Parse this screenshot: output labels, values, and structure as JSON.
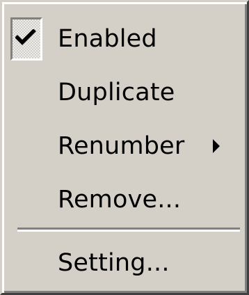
{
  "menu": {
    "items": [
      {
        "label": "Enabled",
        "checked": true,
        "check_icon": "checkmark-icon"
      },
      {
        "label": "Duplicate"
      },
      {
        "label": "Renumber",
        "submenu": true,
        "submenu_icon": "submenu-arrow-icon"
      },
      {
        "label": "Remove..."
      },
      {
        "label": "Setting..."
      }
    ]
  },
  "colors": {
    "menu_background": "#d4d0c8",
    "text": "#000000",
    "shadow": "#808080",
    "highlight": "#ffffff"
  }
}
